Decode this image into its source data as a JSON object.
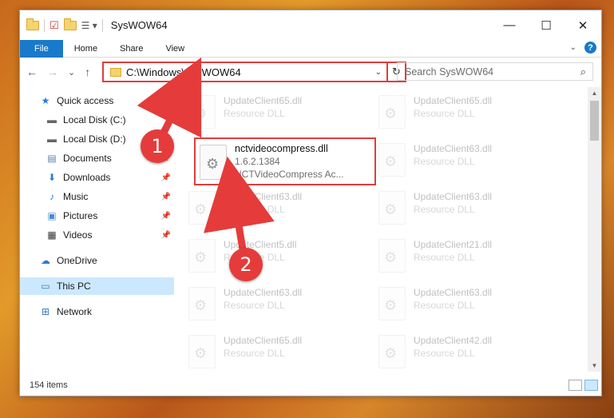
{
  "window": {
    "title": "SysWOW64",
    "controls": {
      "minimize": "—",
      "maximize": "☐",
      "close": "✕"
    }
  },
  "ribbon": {
    "tabs": [
      "File",
      "Home",
      "Share",
      "View"
    ],
    "help_label": "?"
  },
  "navigation": {
    "back": "←",
    "forward": "→",
    "recent": "⌄",
    "up": "↑",
    "address_path": "C:\\Windows\\SysWOW64",
    "refresh": "↻",
    "search_placeholder": "Search SysWOW64"
  },
  "sidebar": {
    "items": [
      {
        "label": "Quick access",
        "icon": "star-icon"
      },
      {
        "label": "Local Disk (C:)",
        "icon": "drive-icon"
      },
      {
        "label": "Local Disk (D:)",
        "icon": "drive-icon"
      },
      {
        "label": "Documents",
        "icon": "documents-icon"
      },
      {
        "label": "Downloads",
        "icon": "download-icon"
      },
      {
        "label": "Music",
        "icon": "music-icon"
      },
      {
        "label": "Pictures",
        "icon": "pictures-icon"
      },
      {
        "label": "Videos",
        "icon": "videos-icon"
      },
      {
        "label": "OneDrive",
        "icon": "cloud-icon"
      },
      {
        "label": "This PC",
        "icon": "computer-icon"
      },
      {
        "label": "Network",
        "icon": "network-icon"
      }
    ]
  },
  "files": [
    {
      "name": "UpdateClient65.dll",
      "type": "Resource DLL"
    },
    {
      "name": "UpdateClient65.dll",
      "type": "Resource DLL"
    },
    {
      "name": "UpdateClient63.dll",
      "type": "Resource DLL"
    },
    {
      "name": "UpdateClient63.dll",
      "type": "Resource DLL"
    },
    {
      "name": "UpdateClient63.dll",
      "type": "Resource DLL"
    },
    {
      "name": "UpdateClient5.dll",
      "type": "Resource DLL"
    },
    {
      "name": "UpdateClient21.dll",
      "type": "Resource DLL"
    },
    {
      "name": "UpdateClient63.dll",
      "type": "Resource DLL"
    },
    {
      "name": "UpdateClient63.dll",
      "type": "Resource DLL"
    },
    {
      "name": "UpdateClient65.dll",
      "type": "Resource DLL"
    },
    {
      "name": "UpdateClient42.dll",
      "type": "Resource DLL"
    }
  ],
  "highlighted_file": {
    "name": "nctvideocompress.dll",
    "version": "1.6.2.1384",
    "description": "NCTVideoCompress Ac..."
  },
  "callouts": [
    "1",
    "2"
  ],
  "status": {
    "item_count": "154 items"
  },
  "colors": {
    "accent": "#1979ca",
    "highlight_red": "#e03c3c",
    "selection": "#cce8ff"
  }
}
